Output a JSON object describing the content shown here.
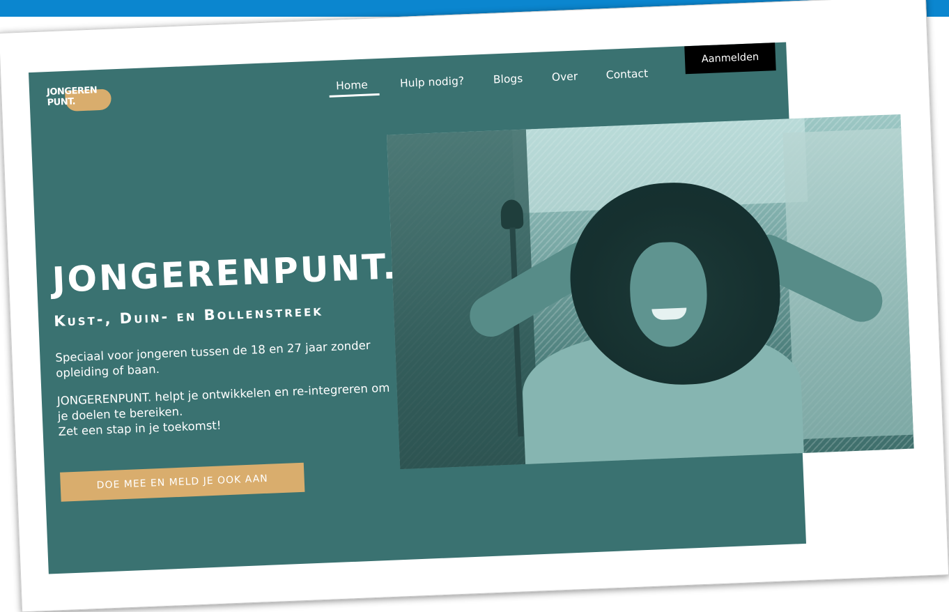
{
  "logo": {
    "text": "JONGEREN\nPUNT."
  },
  "nav": {
    "items": [
      {
        "label": "Home",
        "active": true
      },
      {
        "label": "Hulp nodig?"
      },
      {
        "label": "Blogs"
      },
      {
        "label": "Over"
      },
      {
        "label": "Contact"
      }
    ],
    "cta_label": "Aanmelden"
  },
  "hero": {
    "title": "JONGERENPUNT.",
    "subtitle": "Kust-, Duin- en Bollenstreek",
    "paragraph1": "Speciaal voor jongeren tussen de 18 en 27 jaar zonder opleiding of baan.",
    "paragraph2": "JONGERENPUNT. helpt je ontwikkelen en re-integreren om je doelen te bereiken.",
    "paragraph3": "Zet een stap in je toekomst!",
    "button_label": "DOE MEE EN MELD JE OOK AAN"
  },
  "colors": {
    "brand_teal": "#3a7271",
    "accent_gold": "#d9ad6d",
    "top_band_blue": "#0b86cf",
    "login_bg": "#000000"
  }
}
